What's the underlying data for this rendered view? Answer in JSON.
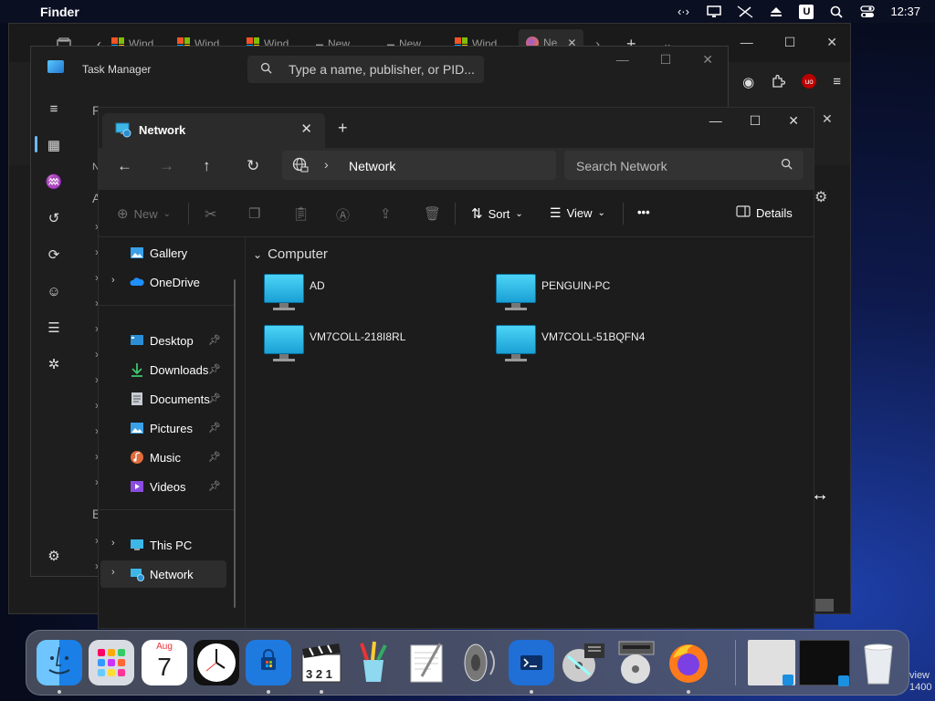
{
  "menubar": {
    "app_name": "Finder",
    "clock": "12:37",
    "status_u": "U"
  },
  "browser": {
    "tabs": [
      "Wind",
      "Wind",
      "Wind",
      "New",
      "New",
      "Wind",
      "Ne"
    ],
    "new_tab": "+"
  },
  "taskmanager": {
    "title": "Task Manager",
    "search_placeholder": "Type a name, publisher, or PID...",
    "letters": [
      "P",
      "N",
      "A",
      "B"
    ]
  },
  "explorer": {
    "tab_title": "Network",
    "address": "Network",
    "search_placeholder": "Search Network",
    "commands": {
      "new": "New",
      "sort": "Sort",
      "view": "View",
      "more": "•••",
      "details": "Details"
    },
    "sidebar": {
      "gallery": "Gallery",
      "onedrive": "OneDrive",
      "desktop": "Desktop",
      "downloads": "Downloads",
      "documents": "Documents",
      "pictures": "Pictures",
      "music": "Music",
      "videos": "Videos",
      "thispc": "This PC",
      "network": "Network"
    },
    "group_label": "Computer",
    "computers": [
      "AD",
      "PENGUIN-PC",
      "VM7COLL-218I8RL",
      "VM7COLL-51BQFN4"
    ]
  },
  "dock": {
    "calendar_month": "Aug",
    "calendar_day": "7",
    "clapper_digits": "3 2 1"
  },
  "corner_text": {
    "line1": "view",
    "line2": "1400"
  },
  "colors": {
    "accent": "#6cb8ff",
    "monitor": "#33c3ee",
    "window_bg": "#1c1c1c"
  }
}
